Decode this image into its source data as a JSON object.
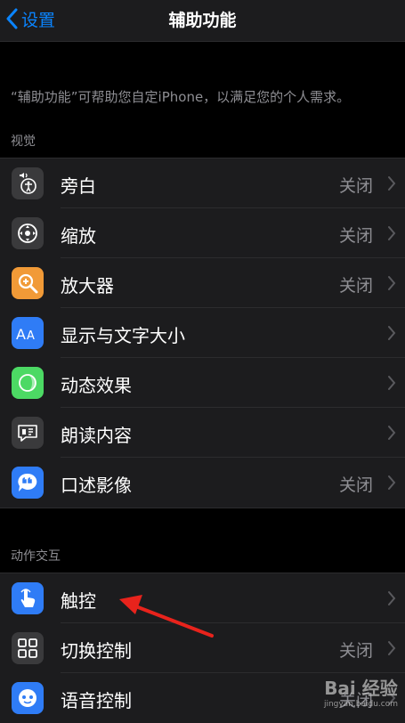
{
  "nav": {
    "back_label": "设置",
    "title": "辅助功能"
  },
  "description": "“辅助功能”可帮助您自定iPhone，以满足您的个人需求。",
  "sections": [
    {
      "header": "视觉",
      "items": [
        {
          "label": "旁白",
          "value": "关闭",
          "icon": "voiceover-icon",
          "color": "#3a3a3c"
        },
        {
          "label": "缩放",
          "value": "关闭",
          "icon": "zoom-icon",
          "color": "#3a3a3c"
        },
        {
          "label": "放大器",
          "value": "关闭",
          "icon": "magnifier-icon",
          "color": "#f19a37"
        },
        {
          "label": "显示与文字大小",
          "value": "",
          "icon": "text-size-icon",
          "color": "#2f7cf6"
        },
        {
          "label": "动态效果",
          "value": "",
          "icon": "motion-icon",
          "color": "#4cd964"
        },
        {
          "label": "朗读内容",
          "value": "",
          "icon": "spoken-content-icon",
          "color": "#3a3a3c"
        },
        {
          "label": "口述影像",
          "value": "关闭",
          "icon": "audio-description-icon",
          "color": "#2f7cf6"
        }
      ]
    },
    {
      "header": "动作交互",
      "items": [
        {
          "label": "触控",
          "value": "",
          "icon": "touch-icon",
          "color": "#2f7cf6"
        },
        {
          "label": "切换控制",
          "value": "关闭",
          "icon": "switch-control-icon",
          "color": "#3a3a3c"
        },
        {
          "label": "语音控制",
          "value": "关闭",
          "icon": "voice-control-icon",
          "color": "#2f7cf6"
        }
      ]
    }
  ],
  "watermark": {
    "logo": "Bai 经验",
    "sub": "jingyan.baidu.com"
  },
  "colors": {
    "accent": "#0a84ff",
    "annotation_arrow": "#e8231c"
  }
}
